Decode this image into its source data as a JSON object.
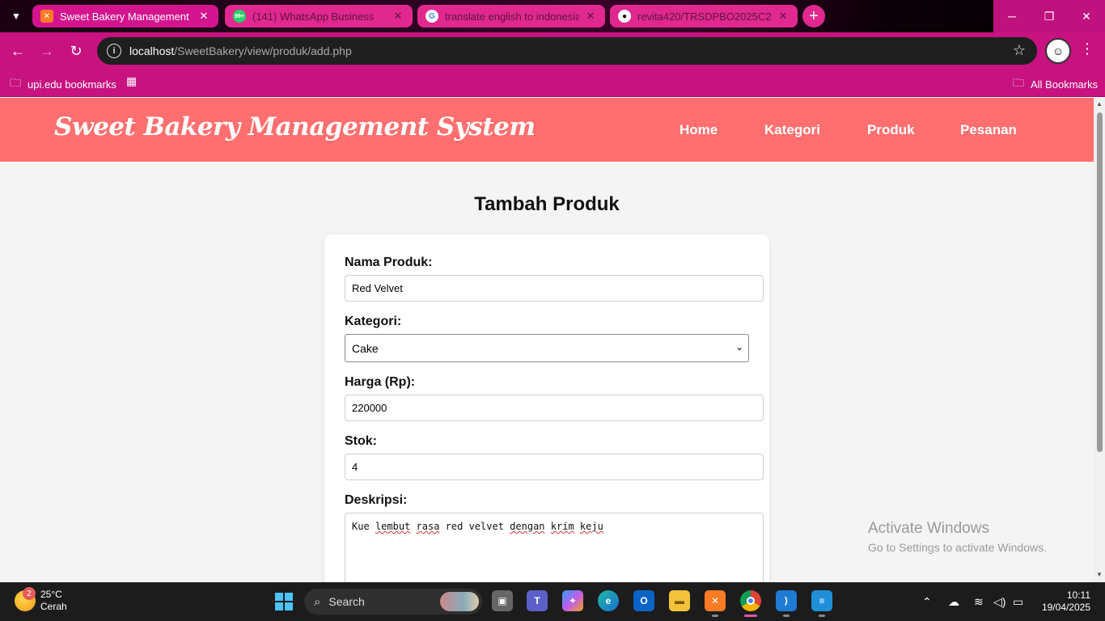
{
  "browser": {
    "tabs": [
      {
        "title": "Sweet Bakery Management Syst",
        "icon": "xampp-icon",
        "active": true
      },
      {
        "title": "(141) WhatsApp Business",
        "icon": "whatsapp-icon",
        "badge": "99+",
        "active": false
      },
      {
        "title": "translate english to indonesia",
        "icon": "google-icon",
        "active": false
      },
      {
        "title": "revita420/TRSDPBO2025C2",
        "icon": "github-icon",
        "active": false
      }
    ],
    "url_host": "localhost",
    "url_path": "/SweetBakery/view/produk/add.php",
    "bookmarks_left": "upi.edu bookmarks",
    "bookmarks_right": "All Bookmarks"
  },
  "site": {
    "brand": "Sweet Bakery Management System",
    "nav": [
      "Home",
      "Kategori",
      "Produk",
      "Pesanan"
    ],
    "header_color": "#ff6f6f"
  },
  "form": {
    "title": "Tambah Produk",
    "fields": {
      "nama_label": "Nama Produk:",
      "nama_value": "Red Velvet",
      "kategori_label": "Kategori:",
      "kategori_value": "Cake",
      "harga_label": "Harga (Rp):",
      "harga_value": "220000",
      "stok_label": "Stok:",
      "stok_value": "4",
      "deskripsi_label": "Deskripsi:",
      "deskripsi_value": "Kue lembut rasa red velvet dengan krim keju"
    }
  },
  "watermark": {
    "line1": "Activate Windows",
    "line2": "Go to Settings to activate Windows."
  },
  "taskbar": {
    "weather_temp": "25°C",
    "weather_desc": "Cerah",
    "weather_badge": "2",
    "search_label": "Search",
    "time": "10:11",
    "date": "19/04/2025"
  }
}
